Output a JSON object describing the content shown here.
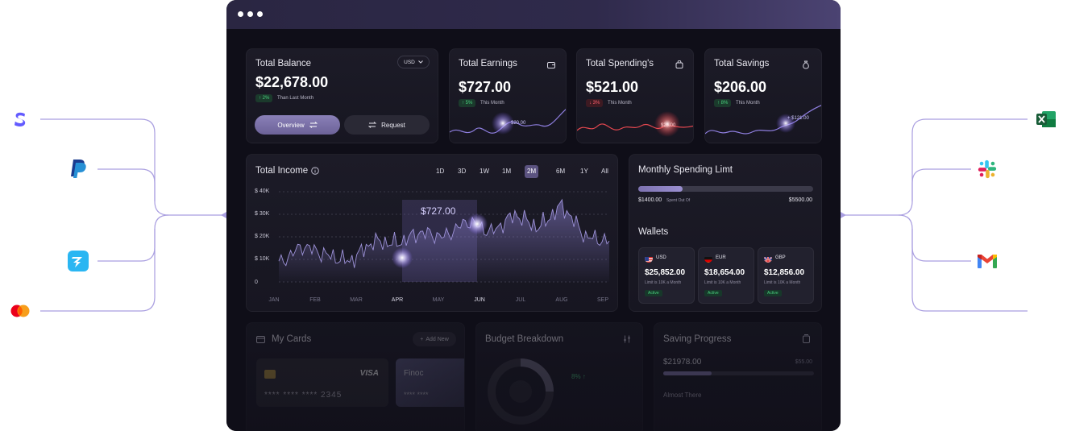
{
  "balance": {
    "title": "Total Balance",
    "currency": "USD",
    "amount": "$22,678.00",
    "change": "↑ 2%",
    "note": "Than Last Month",
    "overview_label": "Overview",
    "request_label": "Request"
  },
  "earnings": {
    "title": "Total Earnings",
    "amount": "$727.00",
    "change": "↑ 5%",
    "note": "This Month",
    "chart_tag": "$20.00"
  },
  "spendings": {
    "title": "Total Spending's",
    "amount": "$521.00",
    "change": "↓ 3%",
    "note": "This Month",
    "chart_tag": "$20.00"
  },
  "savings": {
    "title": "Total Savings",
    "amount": "$206.00",
    "change": "↑ 8%",
    "note": "This Month",
    "chart_tag": "+ $121.00"
  },
  "income": {
    "title": "Total Income",
    "ranges": [
      "1D",
      "3D",
      "1W",
      "1M",
      "2M",
      "6M",
      "1Y",
      "All"
    ],
    "active_range": "2M",
    "tooltip": "$727.00"
  },
  "chart_data": {
    "type": "area",
    "title": "Total Income",
    "xlabel": "",
    "ylabel": "",
    "yticks": [
      "$ 40K",
      "$ 30K",
      "$ 20K",
      "$ 10K",
      "0"
    ],
    "ylim": [
      0,
      40000
    ],
    "categories": [
      "JAN",
      "FEB",
      "MAR",
      "APR",
      "MAY",
      "JUN",
      "JUL",
      "AUG",
      "SEP"
    ],
    "highlight_categories": [
      "APR",
      "JUN"
    ],
    "series": [
      {
        "values": [
          8000,
          16000,
          12000,
          9000,
          18000,
          17000,
          22000,
          20000,
          27000,
          22000,
          30000,
          24000,
          34000,
          20000,
          18000
        ]
      }
    ],
    "grid": true
  },
  "spending_limit": {
    "title": "Monthly Spending Limt",
    "spent": "$1400.00",
    "spent_note": "Spent Out Of",
    "limit": "$5500.00",
    "progress": 0.255
  },
  "wallets": {
    "title": "Wallets",
    "items": [
      {
        "currency": "USD",
        "amount": "$25,852.00",
        "limit": "Limit is 10K a Month",
        "status": "Active"
      },
      {
        "currency": "EUR",
        "amount": "$18,654.00",
        "limit": "Limit is 10K a Month",
        "status": "Active"
      },
      {
        "currency": "GBP",
        "amount": "$12,856.00",
        "limit": "Limit is 10K a Month",
        "status": "Active"
      }
    ]
  },
  "cards": {
    "title": "My Cards",
    "add_label": "Add New",
    "visa_label": "VISA",
    "card_number": "**** **** **** 2345",
    "second_card_name": "Finoc",
    "second_card_number": "**** ****"
  },
  "budget": {
    "title": "Budget Breakdown",
    "change": "8% ↑"
  },
  "saving_progress": {
    "title": "Saving Progress",
    "amount": "$21978.00",
    "target": "$55.00",
    "note": "Almost There"
  },
  "integrations": {
    "left": [
      "stripe-logo",
      "paypal-logo",
      "wise-logo",
      "mastercard-logo"
    ],
    "right": [
      "excel-logo",
      "slack-logo",
      "gmail-logo"
    ]
  }
}
